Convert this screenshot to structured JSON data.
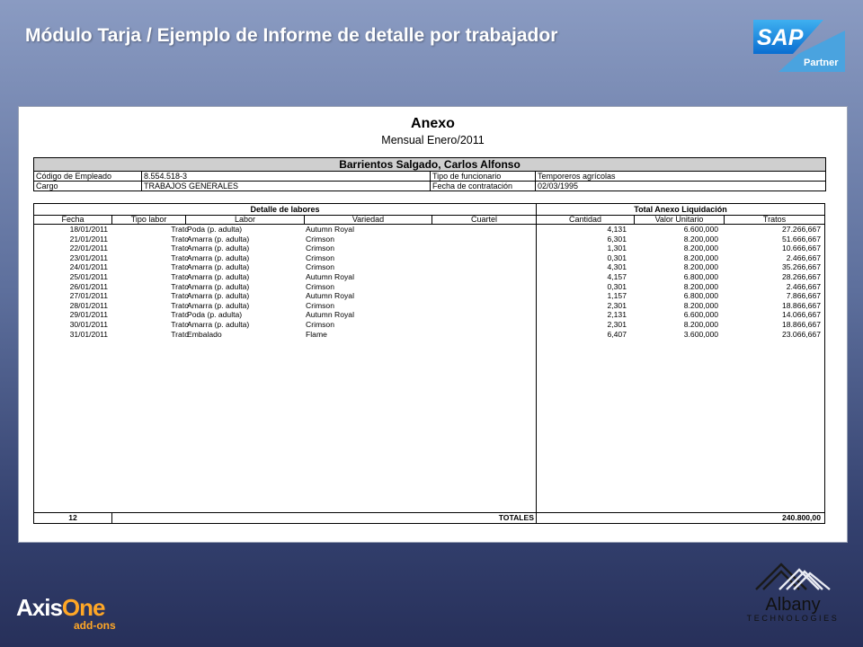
{
  "slide": {
    "title": "Módulo Tarja / Ejemplo de Informe de detalle por trabajador",
    "sap_logo_text": "SAP",
    "sap_badge": "Partner"
  },
  "report": {
    "title": "Anexo",
    "subtitle": "Mensual Enero/2011",
    "employee": {
      "name": "Barrientos Salgado, Carlos Alfonso",
      "code_label": "Código de Empleado",
      "code": "8.554.518-3",
      "type_label": "Tipo de funcionario",
      "type": "Temporeros agrícolas",
      "role_label": "Cargo",
      "role": "TRABAJOS GENERALES",
      "hire_date_label": "Fecha de contratación",
      "hire_date": "02/03/1995"
    },
    "detail_header": "Detalle de labores",
    "liquidation_header": "Total Anexo Liquidación",
    "columns": {
      "fecha": "Fecha",
      "tipo_labor": "Tipo labor",
      "labor": "Labor",
      "variedad": "Variedad",
      "cuartel": "Cuartel",
      "cantidad": "Cantidad",
      "valor_unitario": "Valor Unitario",
      "tratos": "Tratos"
    },
    "rows": [
      {
        "fecha": "18/01/2011",
        "tipo": "Trato",
        "labor": "Poda (p. adulta)",
        "variedad": "Autumn Royal",
        "cuartel": "",
        "cantidad": "4,131",
        "valor": "6.600,000",
        "tratos": "27.266,667"
      },
      {
        "fecha": "21/01/2011",
        "tipo": "Trato",
        "labor": "Amarra (p. adulta)",
        "variedad": "Crimson",
        "cuartel": "",
        "cantidad": "6,301",
        "valor": "8.200,000",
        "tratos": "51.666,667"
      },
      {
        "fecha": "22/01/2011",
        "tipo": "Trato",
        "labor": "Amarra (p. adulta)",
        "variedad": "Crimson",
        "cuartel": "",
        "cantidad": "1,301",
        "valor": "8.200,000",
        "tratos": "10.666,667"
      },
      {
        "fecha": "23/01/2011",
        "tipo": "Trato",
        "labor": "Amarra (p. adulta)",
        "variedad": "Crimson",
        "cuartel": "",
        "cantidad": "0,301",
        "valor": "8.200,000",
        "tratos": "2.466,667"
      },
      {
        "fecha": "24/01/2011",
        "tipo": "Trato",
        "labor": "Amarra (p. adulta)",
        "variedad": "Crimson",
        "cuartel": "",
        "cantidad": "4,301",
        "valor": "8.200,000",
        "tratos": "35.266,667"
      },
      {
        "fecha": "25/01/2011",
        "tipo": "Trato",
        "labor": "Amarra (p. adulta)",
        "variedad": "Autumn Royal",
        "cuartel": "",
        "cantidad": "4,157",
        "valor": "6.800,000",
        "tratos": "28.266,667"
      },
      {
        "fecha": "26/01/2011",
        "tipo": "Trato",
        "labor": "Amarra (p. adulta)",
        "variedad": "Crimson",
        "cuartel": "",
        "cantidad": "0,301",
        "valor": "8.200,000",
        "tratos": "2.466,667"
      },
      {
        "fecha": "27/01/2011",
        "tipo": "Trato",
        "labor": "Amarra (p. adulta)",
        "variedad": "Autumn Royal",
        "cuartel": "",
        "cantidad": "1,157",
        "valor": "6.800,000",
        "tratos": "7.866,667"
      },
      {
        "fecha": "28/01/2011",
        "tipo": "Trato",
        "labor": "Amarra (p. adulta)",
        "variedad": "Crimson",
        "cuartel": "",
        "cantidad": "2,301",
        "valor": "8.200,000",
        "tratos": "18.866,667"
      },
      {
        "fecha": "29/01/2011",
        "tipo": "Trato",
        "labor": "Poda (p. adulta)",
        "variedad": "Autumn Royal",
        "cuartel": "",
        "cantidad": "2,131",
        "valor": "6.600,000",
        "tratos": "14.066,667"
      },
      {
        "fecha": "30/01/2011",
        "tipo": "Trato",
        "labor": "Amarra (p. adulta)",
        "variedad": "Crimson",
        "cuartel": "",
        "cantidad": "2,301",
        "valor": "8.200,000",
        "tratos": "18.866,667"
      },
      {
        "fecha": "31/01/2011",
        "tipo": "Trato",
        "labor": "Embalado",
        "variedad": "Flame",
        "cuartel": "",
        "cantidad": "6,407",
        "valor": "3.600,000",
        "tratos": "23.066,667"
      }
    ],
    "totals": {
      "count": "12",
      "label": "TOTALES",
      "total": "240.800,00"
    }
  },
  "branding": {
    "axis_name_a": "Axis",
    "axis_name_b": "One",
    "axis_sub": "add-ons",
    "albany_name": "Albany",
    "albany_sub": "TECHNOLOGIES"
  },
  "colors": {
    "sap_blue": "#0a6ed1",
    "axis_orange": "#ffa726"
  }
}
